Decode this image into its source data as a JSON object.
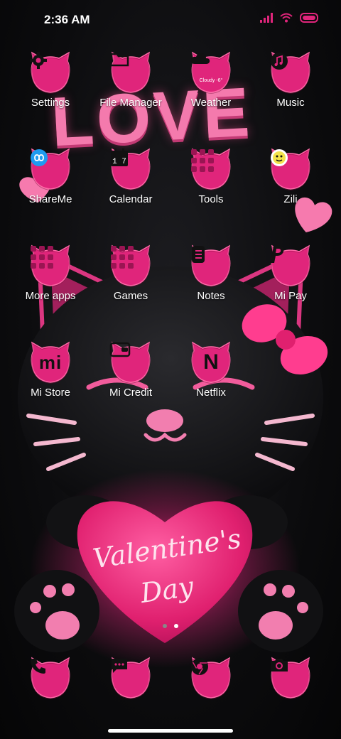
{
  "status": {
    "time": "2:36 AM",
    "signal_icon": "signal-icon",
    "wifi_icon": "wifi-icon",
    "battery_icon": "battery-icon"
  },
  "wallpaper": {
    "headline": "LOVE",
    "heart_text_line1": "Valentine's",
    "heart_text_line2": "Day",
    "colors": {
      "accent": "#e0257b",
      "light_pink": "#f47aad",
      "bg": "#0b0b0d"
    }
  },
  "apps": [
    {
      "label": "Settings",
      "icon": "gear-icon"
    },
    {
      "label": "File Manager",
      "icon": "folder-icon"
    },
    {
      "label": "Weather",
      "icon": "cloud-icon",
      "sub": "Cloudy -6°"
    },
    {
      "label": "Music",
      "icon": "music-note-icon"
    },
    {
      "label": "ShareMe",
      "icon": "infinity-icon"
    },
    {
      "label": "Calendar",
      "icon": "calendar-icon",
      "sub": "17"
    },
    {
      "label": "Tools",
      "icon": "folder-grid-icon"
    },
    {
      "label": "Zili",
      "icon": "smiley-icon"
    },
    {
      "label": "More apps",
      "icon": "folder-grid-icon"
    },
    {
      "label": "Games",
      "icon": "folder-grid-icon"
    },
    {
      "label": "Notes",
      "icon": "notes-icon"
    },
    {
      "label": "Mi Pay",
      "icon": "paypal-icon"
    },
    {
      "label": "Mi Store",
      "icon": "mi-logo-icon",
      "sub": "mi"
    },
    {
      "label": "Mi Credit",
      "icon": "wallet-icon"
    },
    {
      "label": "Netflix",
      "icon": "netflix-icon",
      "sub": "N"
    }
  ],
  "dock": [
    {
      "icon": "phone-icon"
    },
    {
      "icon": "messages-icon"
    },
    {
      "icon": "chrome-icon"
    },
    {
      "icon": "camera-icon"
    }
  ],
  "pages": {
    "count": 2,
    "current": 2
  }
}
